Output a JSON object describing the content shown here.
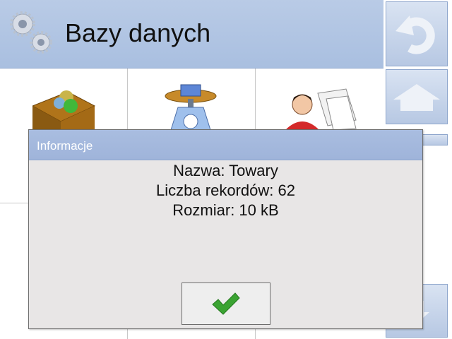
{
  "header": {
    "title": "Bazy danych"
  },
  "dialog": {
    "title": "Informacje",
    "lines": [
      "Nazwa: Towary",
      "Liczba rekordów: 62",
      "Rozmiar: 10 kB"
    ]
  },
  "icons": {
    "header": "gears-icon",
    "back": "back-arrow-icon",
    "home": "home-icon",
    "scroll_down": "down-arrow-icon",
    "ok": "checkmark-icon"
  },
  "colors": {
    "header_bg": "#b1c5e3",
    "dialog_bg": "#e8e6e6",
    "dialog_title_bg": "#a4b9dd",
    "ok_check": "#3aa332"
  }
}
